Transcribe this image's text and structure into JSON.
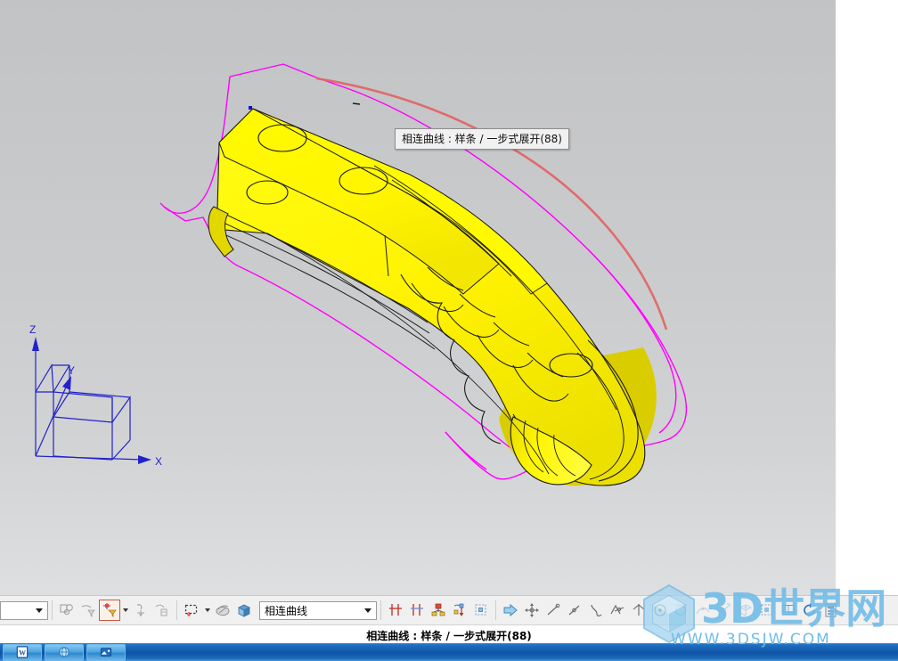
{
  "app": {
    "background_color": "#c8c9cb",
    "model_color": "#ffff00",
    "curve_color": "#ff00ff",
    "highlight_curve_color": "#e06666",
    "accent_color": "#c45b47"
  },
  "viewport": {
    "name": "graphics-window",
    "triad": {
      "x_label": "X",
      "y_label": "Y",
      "z_label": "Z",
      "color": "#2222cc"
    }
  },
  "tooltip": {
    "text": "相连曲线 : 样条 / 一步式展开(88)"
  },
  "statusbar": {
    "text": "相连曲线 : 样条 / 一步式展开(88)"
  },
  "toolbar": {
    "scope_combo": {
      "value": "",
      "placeholder": ""
    },
    "curve_rule_combo": {
      "value": "相连曲线"
    },
    "buttons": [
      {
        "name": "select-general-objects-button",
        "icon": "select-objects-icon",
        "active": false
      },
      {
        "name": "filter-selection-button",
        "icon": "funnel-filter-icon",
        "active": false
      },
      {
        "name": "snap-point-button",
        "icon": "snap-point-filter-icon",
        "active": true
      },
      {
        "name": "snap-point-dropdown",
        "icon": "chevron-down-icon",
        "active": false
      },
      {
        "name": "select-feature-button",
        "icon": "feature-node-icon",
        "active": false
      },
      {
        "name": "select-component-button",
        "icon": "component-pick-icon",
        "active": false
      },
      {
        "name": "rectangle-select-button",
        "icon": "rectangle-marquee-icon",
        "active": false
      },
      {
        "name": "rectangle-select-dropdown",
        "icon": "chevron-down-icon",
        "active": false
      },
      {
        "name": "face-select-button",
        "icon": "shaded-face-icon",
        "active": false
      },
      {
        "name": "solid-body-select-button",
        "icon": "solid-cube-icon",
        "active": false
      },
      {
        "name": "stop-at-intersection-button",
        "icon": "stop-at-intersection-icon",
        "active": false
      },
      {
        "name": "follow-fillet-button",
        "icon": "follow-fillet-icon",
        "active": false
      },
      {
        "name": "chain-within-features-button",
        "icon": "chain-features-icon",
        "active": false
      },
      {
        "name": "curve-rule-options-button",
        "icon": "curve-options-icon",
        "active": false
      },
      {
        "name": "snap-grid-button",
        "icon": "snap-grid-icon",
        "active": false
      },
      {
        "name": "direction-arrow-button",
        "icon": "arrow-right-icon",
        "active": false
      },
      {
        "name": "point-constructor-button",
        "icon": "point-move-icon",
        "active": false
      },
      {
        "name": "end-point-snap-button",
        "icon": "endpoint-snap-icon",
        "active": false
      },
      {
        "name": "midpoint-snap-button",
        "icon": "midpoint-snap-icon",
        "active": false
      },
      {
        "name": "control-point-snap-button",
        "icon": "control-point-icon",
        "active": false
      },
      {
        "name": "intersection-snap-button",
        "icon": "intersection-snap-icon",
        "active": false
      },
      {
        "name": "quadrant-snap-button",
        "icon": "quadrant-snap-icon",
        "active": false
      },
      {
        "name": "center-snap-button",
        "icon": "center-snap-icon",
        "active": false
      },
      {
        "name": "tangent-snap-button",
        "icon": "tangent-snap-icon",
        "active": false
      },
      {
        "name": "point-on-curve-button",
        "icon": "point-on-curve-icon",
        "active": false
      },
      {
        "name": "existing-point-button",
        "icon": "existing-point-icon",
        "active": false
      },
      {
        "name": "face-point-button",
        "icon": "point-on-face-icon",
        "active": false
      },
      {
        "name": "wcs-snap-button",
        "icon": "wcs-snap-icon",
        "active": false
      },
      {
        "name": "grid-snap-toggle-button",
        "icon": "grid-snap-toggle-icon",
        "active": false
      },
      {
        "name": "refresh-view-button",
        "icon": "refresh-circle-icon",
        "active": false
      },
      {
        "name": "display-mode-button",
        "icon": "display-mode-icon",
        "active": false
      }
    ]
  },
  "taskbar": {
    "items": [
      {
        "name": "taskbar-item-word",
        "icon": "word-document-icon",
        "glyph": "W"
      },
      {
        "name": "taskbar-item-browser",
        "icon": "browser-globe-icon",
        "glyph": ""
      },
      {
        "name": "taskbar-item-app",
        "icon": "blue-app-icon",
        "glyph": ""
      }
    ]
  },
  "watermark": {
    "brand_cn": "3D世界网",
    "url": "WWW.3DSJW.COM",
    "color": "#77c0ea"
  }
}
